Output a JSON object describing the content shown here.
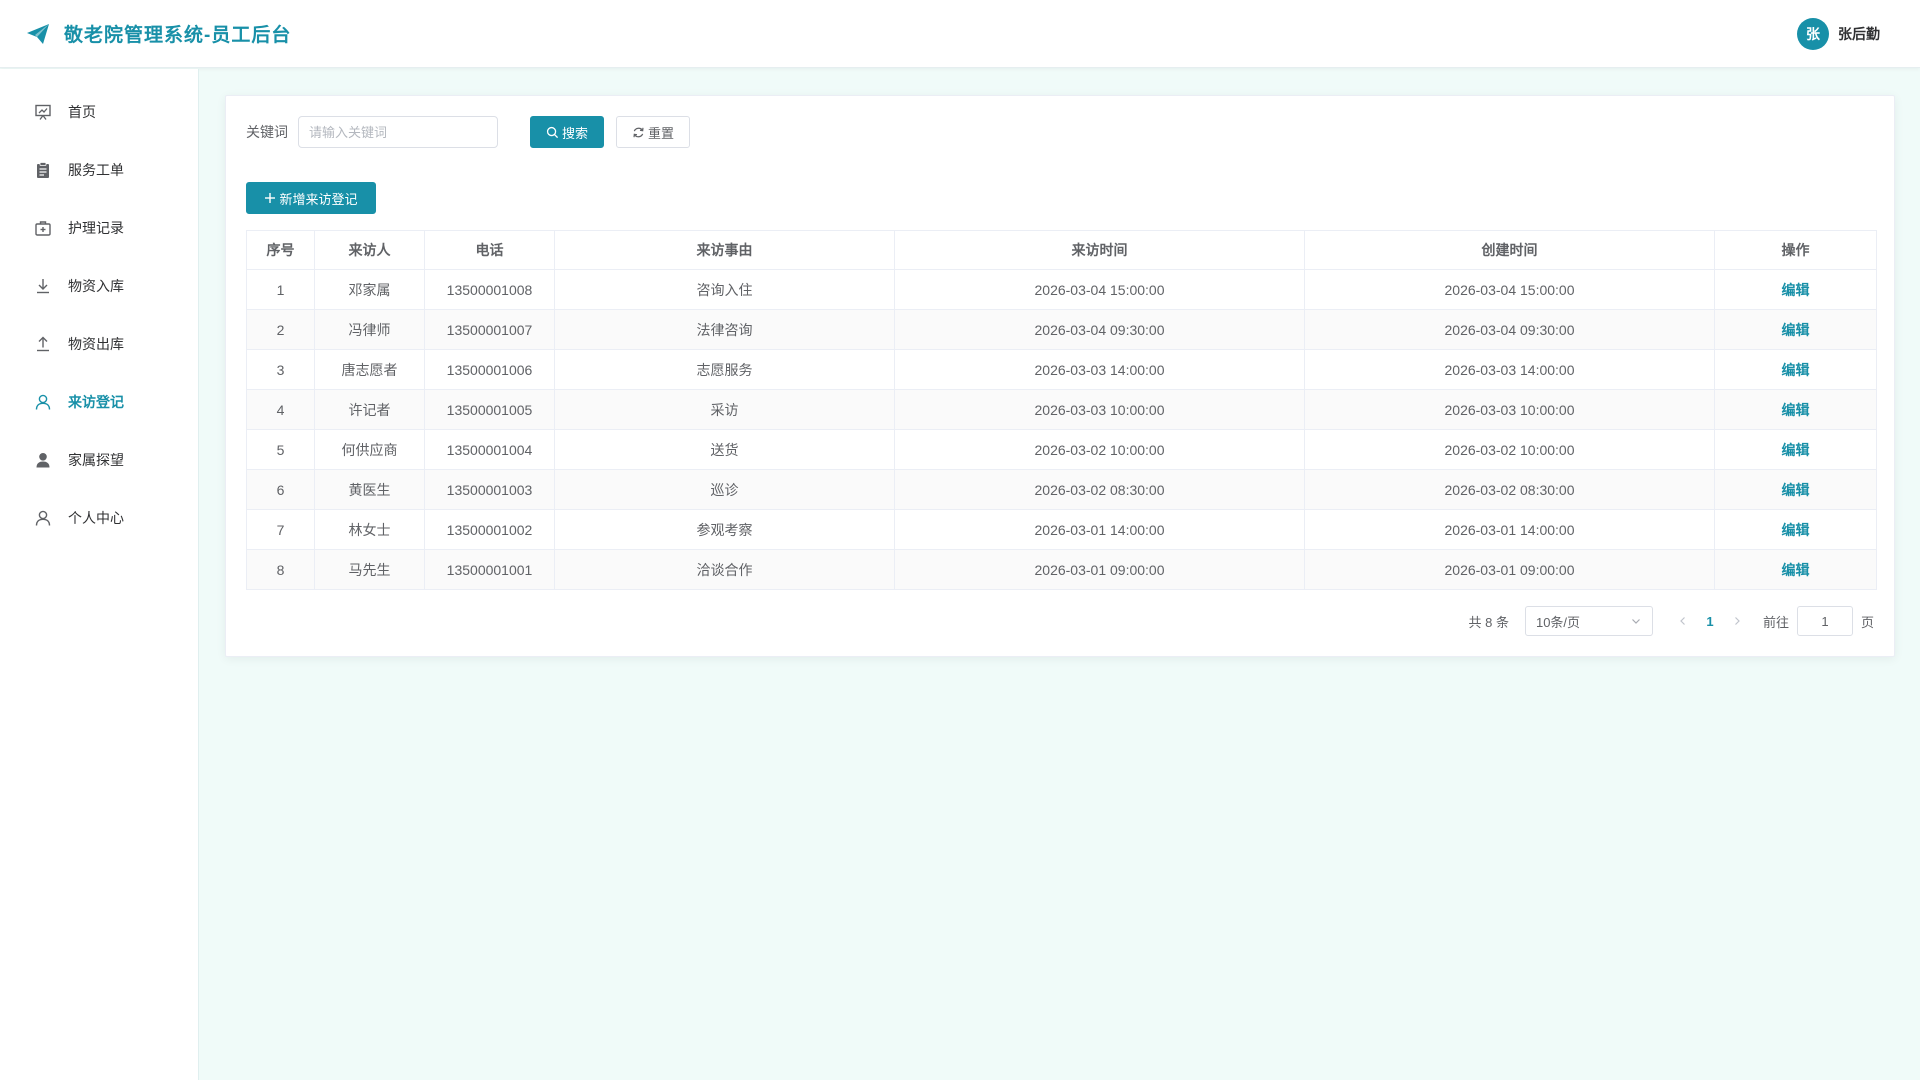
{
  "header": {
    "title": "敬老院管理系统-员工后台",
    "user": {
      "avatar_text": "张",
      "name": "张后勤"
    }
  },
  "sidebar": {
    "items": [
      {
        "label": "首页",
        "icon": "chart-board-icon",
        "active": false
      },
      {
        "label": "服务工单",
        "icon": "clipboard-icon",
        "active": false
      },
      {
        "label": "护理记录",
        "icon": "first-aid-kit-icon",
        "active": false
      },
      {
        "label": "物资入库",
        "icon": "download-icon",
        "active": false
      },
      {
        "label": "物资出库",
        "icon": "upload-icon",
        "active": false
      },
      {
        "label": "来访登记",
        "icon": "user-icon",
        "active": true
      },
      {
        "label": "家属探望",
        "icon": "user-filled-icon",
        "active": false
      },
      {
        "label": "个人中心",
        "icon": "user-icon",
        "active": false
      }
    ]
  },
  "search": {
    "label": "关键词",
    "placeholder": "请输入关键词",
    "value": "",
    "search_label": "搜索",
    "reset_label": "重置"
  },
  "toolbar": {
    "add_label": "新增来访登记"
  },
  "table": {
    "columns": [
      "序号",
      "来访人",
      "电话",
      "来访事由",
      "来访时间",
      "创建时间",
      "操作"
    ],
    "rows": [
      {
        "index": "1",
        "visitor": "邓家属",
        "phone": "13500001008",
        "reason": "咨询入住",
        "visit_time": "2026-03-04 15:00:00",
        "created": "2026-03-04 15:00:00",
        "action": "编辑"
      },
      {
        "index": "2",
        "visitor": "冯律师",
        "phone": "13500001007",
        "reason": "法律咨询",
        "visit_time": "2026-03-04 09:30:00",
        "created": "2026-03-04 09:30:00",
        "action": "编辑"
      },
      {
        "index": "3",
        "visitor": "唐志愿者",
        "phone": "13500001006",
        "reason": "志愿服务",
        "visit_time": "2026-03-03 14:00:00",
        "created": "2026-03-03 14:00:00",
        "action": "编辑"
      },
      {
        "index": "4",
        "visitor": "许记者",
        "phone": "13500001005",
        "reason": "采访",
        "visit_time": "2026-03-03 10:00:00",
        "created": "2026-03-03 10:00:00",
        "action": "编辑"
      },
      {
        "index": "5",
        "visitor": "何供应商",
        "phone": "13500001004",
        "reason": "送货",
        "visit_time": "2026-03-02 10:00:00",
        "created": "2026-03-02 10:00:00",
        "action": "编辑"
      },
      {
        "index": "6",
        "visitor": "黄医生",
        "phone": "13500001003",
        "reason": "巡诊",
        "visit_time": "2026-03-02 08:30:00",
        "created": "2026-03-02 08:30:00",
        "action": "编辑"
      },
      {
        "index": "7",
        "visitor": "林女士",
        "phone": "13500001002",
        "reason": "参观考察",
        "visit_time": "2026-03-01 14:00:00",
        "created": "2026-03-01 14:00:00",
        "action": "编辑"
      },
      {
        "index": "8",
        "visitor": "马先生",
        "phone": "13500001001",
        "reason": "洽谈合作",
        "visit_time": "2026-03-01 09:00:00",
        "created": "2026-03-01 09:00:00",
        "action": "编辑"
      }
    ]
  },
  "pagination": {
    "total_text": "共 8 条",
    "page_size": "10条/页",
    "current_page": "1",
    "goto_label": "前往",
    "goto_value": "1",
    "goto_suffix": "页"
  },
  "colors": {
    "accent": "#1890a8",
    "background": "#f0fbf9"
  }
}
